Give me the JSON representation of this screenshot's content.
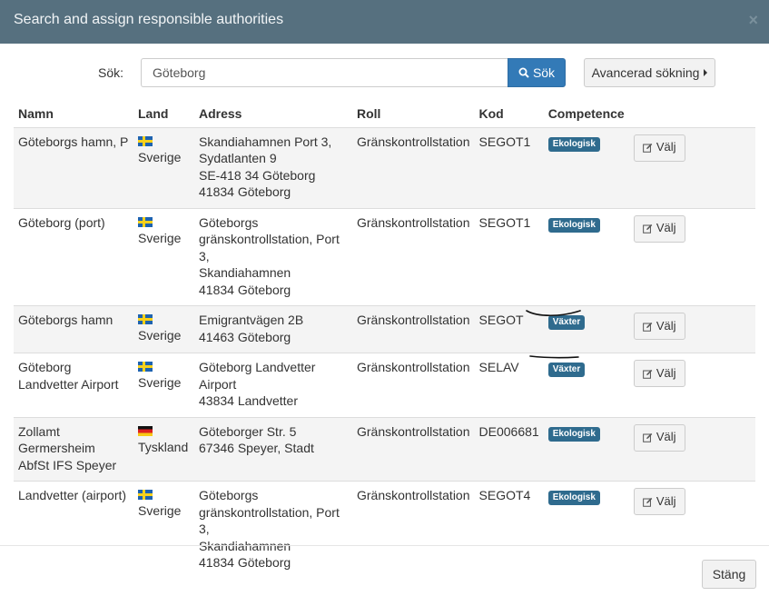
{
  "dialog": {
    "title": "Search and assign responsible authorities",
    "close_symbol": "×"
  },
  "search": {
    "label": "Sök:",
    "value": "Göteborg",
    "button_label": "Sök",
    "advanced_label": "Avancerad sökning"
  },
  "table": {
    "headers": {
      "name": "Namn",
      "land": "Land",
      "adress": "Adress",
      "roll": "Roll",
      "kod": "Kod",
      "competence": "Competence"
    },
    "select_label": "Välj",
    "rows": [
      {
        "name_lines": [
          "Göteborgs hamn, P"
        ],
        "flag": "se",
        "land": "Sverige",
        "adress_lines": [
          "Skandiahamnen Port 3,",
          "Sydatlanten 9",
          "SE-418 34 Göteborg",
          "41834 Göteborg"
        ],
        "roll": "Gränskontrollstation",
        "kod": "SEGOT1",
        "competence": "Ekologisk"
      },
      {
        "name_lines": [
          "Göteborg (port)"
        ],
        "flag": "se",
        "land": "Sverige",
        "adress_lines": [
          "Göteborgs",
          "gränskontrollstation, Port 3,",
          "Skandiahamnen",
          "41834 Göteborg"
        ],
        "roll": "Gränskontrollstation",
        "kod": "SEGOT1",
        "competence": "Ekologisk"
      },
      {
        "name_lines": [
          "Göteborgs hamn"
        ],
        "flag": "se",
        "land": "Sverige",
        "adress_lines": [
          "Emigrantvägen 2B",
          "41463 Göteborg"
        ],
        "roll": "Gränskontrollstation",
        "kod": "SEGOT",
        "competence": "Växter"
      },
      {
        "name_lines": [
          "Göteborg",
          "Landvetter Airport"
        ],
        "flag": "se",
        "land": "Sverige",
        "adress_lines": [
          "Göteborg Landvetter Airport",
          "43834 Landvetter"
        ],
        "roll": "Gränskontrollstation",
        "kod": "SELAV",
        "competence": "Växter"
      },
      {
        "name_lines": [
          "Zollamt",
          "Germersheim",
          "AbfSt IFS Speyer"
        ],
        "flag": "de",
        "land": "Tyskland",
        "adress_lines": [
          "Göteborger Str. 5",
          "67346 Speyer, Stadt"
        ],
        "roll": "Gränskontrollstation",
        "kod": "DE006681",
        "competence": "Ekologisk"
      },
      {
        "name_lines": [
          "Landvetter (airport)"
        ],
        "flag": "se",
        "land": "Sverige",
        "adress_lines": [
          "Göteborgs",
          "gränskontrollstation, Port 3,",
          "Skandiahamnen",
          "41834 Göteborg"
        ],
        "roll": "Gränskontrollstation",
        "kod": "SEGOT4",
        "competence": "Ekologisk"
      }
    ]
  },
  "footer": {
    "close_label": "Stäng"
  },
  "colors": {
    "header_bg": "#56707f",
    "primary": "#337ab7",
    "badge": "#2f6b8e"
  },
  "icons": {
    "search": "search-icon",
    "edit": "edit-icon",
    "close": "close-icon",
    "caret": "caret-right-icon"
  }
}
